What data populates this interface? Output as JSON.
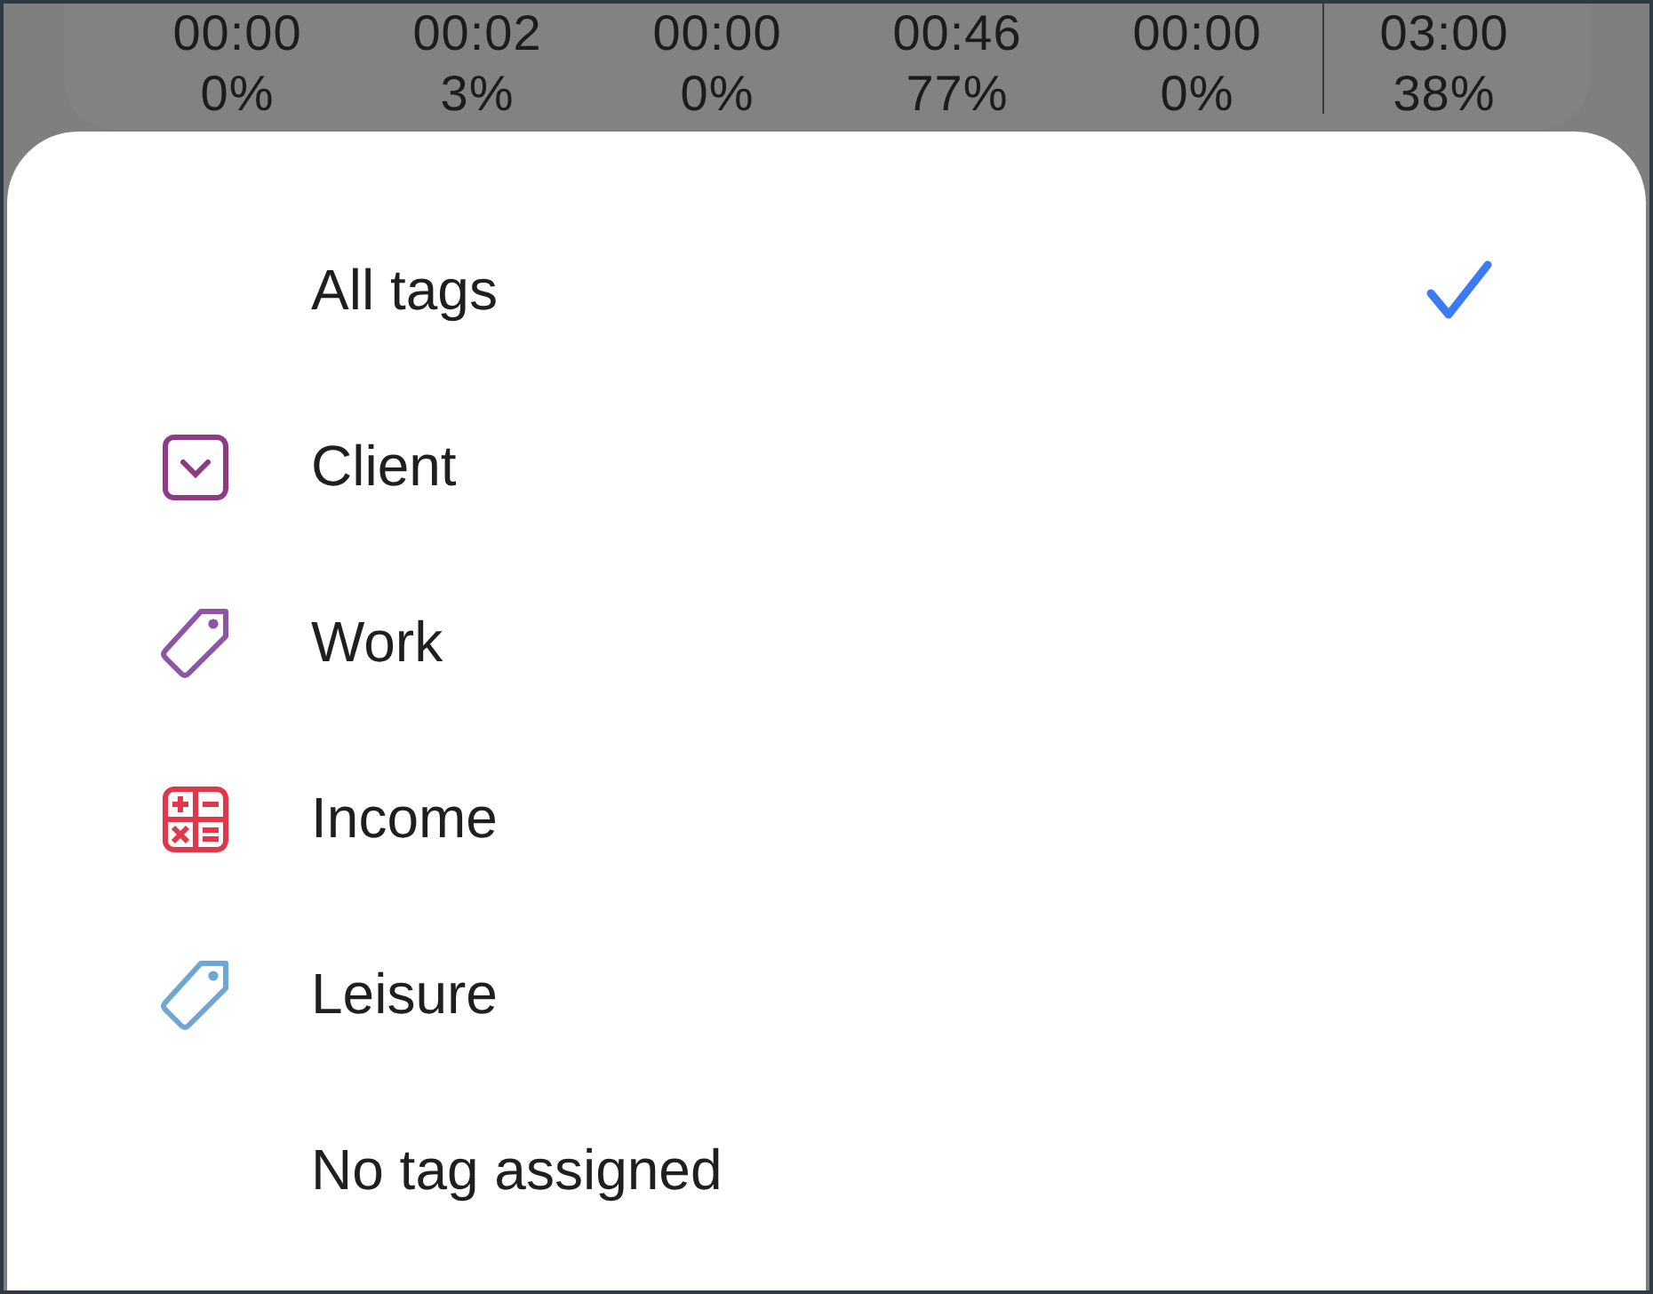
{
  "stats": [
    {
      "time": "00:00",
      "percent": "0%"
    },
    {
      "time": "00:02",
      "percent": "3%"
    },
    {
      "time": "00:00",
      "percent": "0%"
    },
    {
      "time": "00:46",
      "percent": "77%"
    },
    {
      "time": "00:00",
      "percent": "0%"
    },
    {
      "time": "03:00",
      "percent": "38%",
      "total": true
    }
  ],
  "tag_menu": {
    "items": [
      {
        "label": "All tags",
        "kind": "none",
        "selected": true
      },
      {
        "label": "Client",
        "kind": "client",
        "color": "#8e3a84",
        "selected": false
      },
      {
        "label": "Work",
        "kind": "tag",
        "color": "#8e55a6",
        "selected": false
      },
      {
        "label": "Income",
        "kind": "calculator",
        "color": "#e0384a",
        "selected": false
      },
      {
        "label": "Leisure",
        "kind": "tag",
        "color": "#6ea6d4",
        "selected": false
      },
      {
        "label": "No tag assigned",
        "kind": "none",
        "selected": false
      }
    ]
  }
}
